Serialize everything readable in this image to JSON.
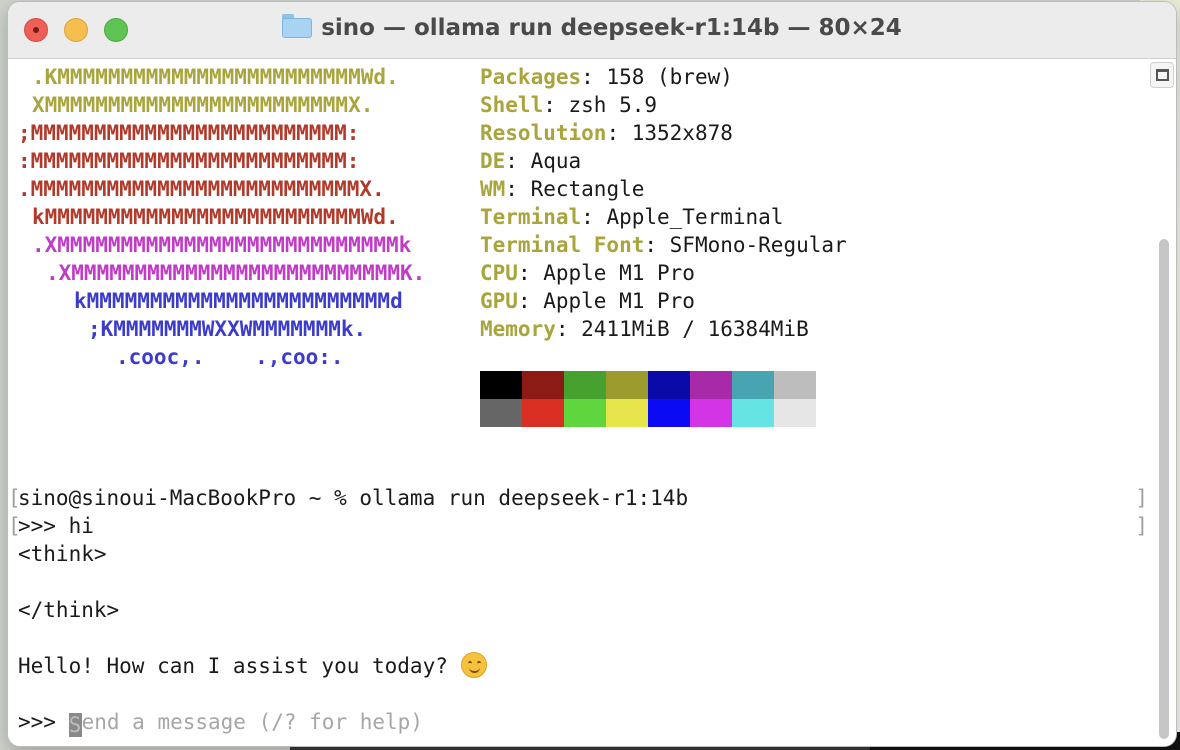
{
  "window": {
    "title": "sino — ollama run deepseek-r1:14b — 80×24"
  },
  "logo_lines": [
    {
      "text": ".KMMMMMMMMMMMMMMMMMMMMMMMMWd.",
      "color": "olive"
    },
    {
      "text": "XMMMMMMMMMMMMMMMMMMMMMMMMX.",
      "color": "olive"
    },
    {
      "text": ";MMMMMMMMMMMMMMMMMMMMMMMMM:",
      "color": "red"
    },
    {
      "text": ":MMMMMMMMMMMMMMMMMMMMMMMMM:",
      "color": "red"
    },
    {
      "text": ".MMMMMMMMMMMMMMMMMMMMMMMMMMX.",
      "color": "red"
    },
    {
      "text": "kMMMMMMMMMMMMMMMMMMMMMMMMMWd.",
      "color": "red"
    },
    {
      "text": ".XMMMMMMMMMMMMMMMMMMMMMMMMMMMk",
      "color": "magenta"
    },
    {
      "text": ".XMMMMMMMMMMMMMMMMMMMMMMMMMMK.",
      "color": "magenta"
    },
    {
      "text": "kMMMMMMMMMMMMMMMMMMMMMMMMd",
      "color": "blue"
    },
    {
      "text": ";KMMMMMMMWXXWMMMMMMMk.",
      "color": "blue"
    },
    {
      "text": ".cooc,.    .,coo:.",
      "color": "blue"
    }
  ],
  "sysinfo": [
    {
      "label": "Packages",
      "value": ": 158 (brew)"
    },
    {
      "label": "Shell",
      "value": ": zsh 5.9"
    },
    {
      "label": "Resolution",
      "value": ": 1352x878"
    },
    {
      "label": "DE",
      "value": ": Aqua"
    },
    {
      "label": "WM",
      "value": ": Rectangle"
    },
    {
      "label": "Terminal",
      "value": ": Apple_Terminal"
    },
    {
      "label": "Terminal Font",
      "value": ": SFMono-Regular"
    },
    {
      "label": "CPU",
      "value": ": Apple M1 Pro"
    },
    {
      "label": "GPU",
      "value": ": Apple M1 Pro"
    },
    {
      "label": "Memory",
      "value": ": 2411MiB / 16384MiB"
    }
  ],
  "palette": {
    "normal": [
      "#000000",
      "#8c1a15",
      "#47a12e",
      "#9b9b2e",
      "#0a0aa8",
      "#a82aa8",
      "#49a4b2",
      "#bdbdbd"
    ],
    "bright": [
      "#666666",
      "#d82f22",
      "#5fd63e",
      "#e6e64c",
      "#0a0af5",
      "#d335e6",
      "#66e3e3",
      "#e6e6e6"
    ]
  },
  "session": {
    "command_line": "sino@sinoui-MacBookPro ~ % ollama run deepseek-r1:14b",
    "user_prompt": ">>> hi",
    "think_open": "<think>",
    "think_close": "</think>",
    "response": "Hello! How can I assist you today?",
    "response_emoji": "smiling-face-icon",
    "input_prompt": ">>>",
    "input_placeholder": "Send a message (/? for help)",
    "input_placeholder_first": "S",
    "input_placeholder_rest": "end a message (/? for help)"
  }
}
